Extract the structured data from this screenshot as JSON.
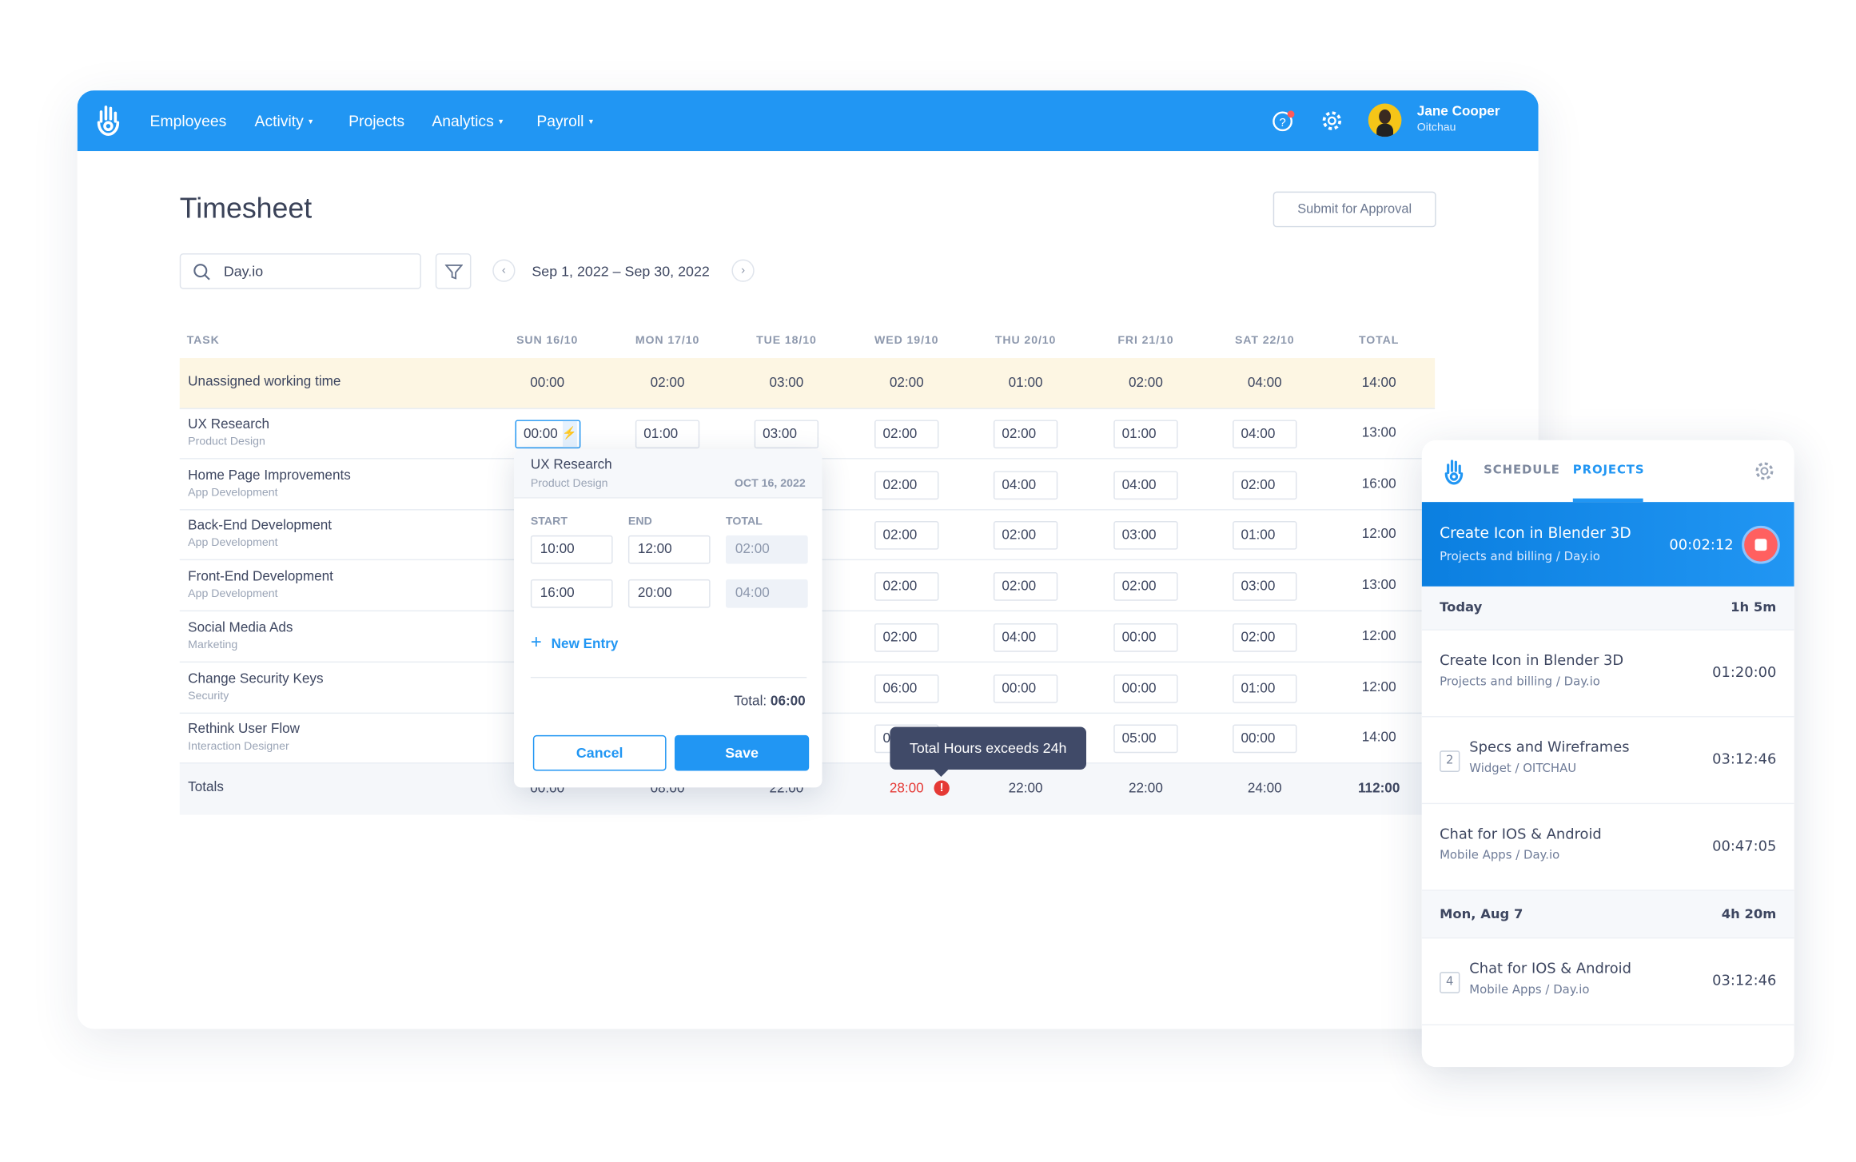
{
  "nav": {
    "items": [
      {
        "label": "Employees",
        "dropdown": false
      },
      {
        "label": "Activity",
        "dropdown": true
      },
      {
        "label": "Projects",
        "dropdown": false
      },
      {
        "label": "Analytics",
        "dropdown": true
      },
      {
        "label": "Payroll",
        "dropdown": true
      }
    ],
    "user_name": "Jane Cooper",
    "user_org": "Oitchau",
    "brand_color": "#2196f3"
  },
  "page": {
    "title": "Timesheet",
    "submit_label": "Submit for Approval",
    "search_value": "Day.io",
    "date_range": "Sep 1, 2022 – Sep 30, 2022"
  },
  "table": {
    "headers": [
      "TASK",
      "SUN 16/10",
      "MON 17/10",
      "TUE 18/10",
      "WED 19/10",
      "THU 20/10",
      "FRI 21/10",
      "SAT 22/10",
      "TOTAL"
    ],
    "unassigned": {
      "label": "Unassigned working time",
      "values": [
        "00:00",
        "02:00",
        "03:00",
        "02:00",
        "01:00",
        "02:00",
        "04:00"
      ],
      "total": "14:00"
    },
    "rows": [
      {
        "name": "UX Research",
        "sub": "Product Design",
        "values": [
          "00:00",
          "01:00",
          "03:00",
          "02:00",
          "02:00",
          "01:00",
          "04:00"
        ],
        "total": "13:00"
      },
      {
        "name": "Home Page Improvements",
        "sub": "App Development",
        "values": [
          null,
          null,
          null,
          "02:00",
          "04:00",
          "04:00",
          "02:00"
        ],
        "total": "16:00"
      },
      {
        "name": "Back-End Development",
        "sub": "App Development",
        "values": [
          null,
          null,
          null,
          "02:00",
          "02:00",
          "03:00",
          "01:00"
        ],
        "total": "12:00"
      },
      {
        "name": "Front-End Development",
        "sub": "App Development",
        "values": [
          null,
          null,
          null,
          "02:00",
          "02:00",
          "02:00",
          "03:00"
        ],
        "total": "13:00"
      },
      {
        "name": "Social Media Ads",
        "sub": "Marketing",
        "values": [
          null,
          null,
          null,
          "02:00",
          "04:00",
          "00:00",
          "02:00"
        ],
        "total": "12:00"
      },
      {
        "name": "Change Security Keys",
        "sub": "Security",
        "values": [
          null,
          null,
          null,
          "06:00",
          "00:00",
          "00:00",
          "01:00"
        ],
        "total": "12:00"
      },
      {
        "name": "Rethink User Flow",
        "sub": "Interaction Designer",
        "values": [
          null,
          null,
          null,
          "0",
          null,
          "05:00",
          "00:00"
        ],
        "total": "14:00"
      }
    ],
    "totals": {
      "label": "Totals",
      "values": [
        "00:00",
        "08:00",
        "22:00",
        "28:00",
        "22:00",
        "22:00",
        "24:00"
      ],
      "total": "112:00",
      "error_color": "#e53935"
    }
  },
  "popover": {
    "task": "UX Research",
    "sub": "Product Design",
    "date": "OCT 16, 2022",
    "col_start": "START",
    "col_end": "END",
    "col_total": "TOTAL",
    "entries": [
      {
        "start": "10:00",
        "end": "12:00",
        "total": "02:00"
      },
      {
        "start": "16:00",
        "end": "20:00",
        "total": "04:00"
      }
    ],
    "new_entry": "New Entry",
    "total_label": "Total:",
    "total_value": "06:00",
    "cancel": "Cancel",
    "save": "Save"
  },
  "tooltip": "Total Hours exceeds 24h",
  "panel": {
    "tab_schedule": "SCHEDULE",
    "tab_projects": "PROJECTS",
    "active": {
      "title": "Create Icon in Blender 3D",
      "project": "Projects and billing",
      "client": "Day.io",
      "timer": "00:02:12"
    },
    "groups": [
      {
        "label": "Today",
        "total": "1h 5m",
        "items": [
          {
            "title": "Create Icon in Blender 3D",
            "project": "Projects and billing",
            "client": "Day.io",
            "time": "01:20:00",
            "count": null
          },
          {
            "title": "Specs and Wireframes",
            "project": "Widget",
            "client": "OITCHAU",
            "time": "03:12:46",
            "count": "2"
          },
          {
            "title": "Chat for IOS & Android",
            "project": "Mobile Apps",
            "client": "Day.io",
            "time": "00:47:05",
            "count": null
          }
        ]
      },
      {
        "label": "Mon, Aug 7",
        "total": "4h 20m",
        "items": [
          {
            "title": "Chat for IOS & Android",
            "project": "Mobile Apps",
            "client": "Day.io",
            "time": "03:12:46",
            "count": "4"
          }
        ]
      }
    ]
  }
}
